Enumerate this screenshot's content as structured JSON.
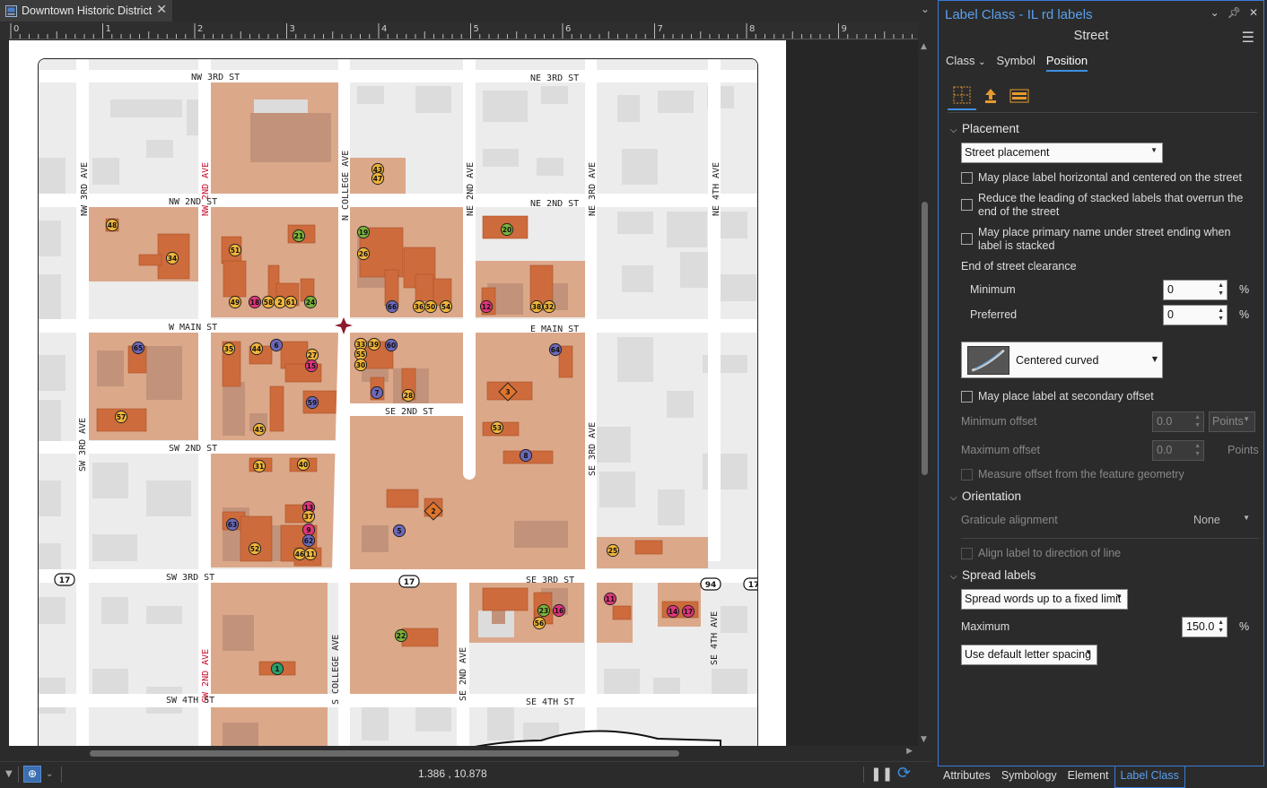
{
  "document_tab": {
    "title": "Downtown Historic District"
  },
  "ruler": {
    "labels": [
      "0",
      "1",
      "2",
      "3",
      "4",
      "5",
      "6",
      "7",
      "8",
      "9"
    ]
  },
  "map": {
    "streets": {
      "nw3rd_st": "NW 3RD ST",
      "ne3rd_st": "NE 3RD ST",
      "nw2nd_st": "NW 2ND ST",
      "ne2nd_st": "NE 2ND ST",
      "w_main_st": "W MAIN ST",
      "e_main_st": "E MAIN ST",
      "se2nd_st": "SE 2ND ST",
      "sw2nd_st": "SW 2ND ST",
      "sw3rd_st": "SW 3RD ST",
      "se3rd_st": "SE 3RD ST",
      "sw4th_st": "SW 4TH ST",
      "se4th_st": "SE 4TH ST",
      "nw3rd_ave": "NW 3RD AVE",
      "nw2nd_ave": "NW 2ND AVE",
      "n_college_ave": "N COLLEGE AVE",
      "ne2nd_ave": "NE 2ND AVE",
      "ne3rd_ave": "NE 3RD AVE",
      "ne4th_ave": "NE 4TH AVE",
      "sw3rd_ave": "SW 3RD AVE",
      "se3rd_ave": "SE 3RD AVE",
      "sw2nd_ave": "SW 2ND AVE",
      "s_college_ave": "S COLLEGE AVE",
      "se2nd_ave": "SE 2ND AVE",
      "se4th_ave": "SE 4TH AVE"
    },
    "shields": [
      "17",
      "17",
      "94",
      "17"
    ],
    "markers": [
      {
        "n": "48",
        "c": "yellow"
      },
      {
        "n": "34",
        "c": "yellow"
      },
      {
        "n": "51",
        "c": "yellow"
      },
      {
        "n": "21",
        "c": "green"
      },
      {
        "n": "49",
        "c": "yellow"
      },
      {
        "n": "18",
        "c": "pink"
      },
      {
        "n": "58",
        "c": "yellow"
      },
      {
        "n": "2",
        "c": "yellow"
      },
      {
        "n": "61",
        "c": "yellow"
      },
      {
        "n": "24",
        "c": "green"
      },
      {
        "n": "43",
        "c": "yellow"
      },
      {
        "n": "47",
        "c": "yellow"
      },
      {
        "n": "19",
        "c": "green"
      },
      {
        "n": "26",
        "c": "yellow"
      },
      {
        "n": "66",
        "c": "purple"
      },
      {
        "n": "36",
        "c": "yellow"
      },
      {
        "n": "50",
        "c": "yellow"
      },
      {
        "n": "54",
        "c": "yellow"
      },
      {
        "n": "20",
        "c": "green"
      },
      {
        "n": "12",
        "c": "pink"
      },
      {
        "n": "38",
        "c": "yellow"
      },
      {
        "n": "32",
        "c": "yellow"
      },
      {
        "n": "65",
        "c": "purple"
      },
      {
        "n": "35",
        "c": "yellow"
      },
      {
        "n": "44",
        "c": "yellow"
      },
      {
        "n": "6",
        "c": "purple"
      },
      {
        "n": "27",
        "c": "yellow"
      },
      {
        "n": "15",
        "c": "pink"
      },
      {
        "n": "33",
        "c": "yellow"
      },
      {
        "n": "39",
        "c": "yellow"
      },
      {
        "n": "60",
        "c": "purple"
      },
      {
        "n": "55",
        "c": "yellow"
      },
      {
        "n": "30",
        "c": "yellow"
      },
      {
        "n": "64",
        "c": "purple"
      },
      {
        "n": "59",
        "c": "purple"
      },
      {
        "n": "7",
        "c": "purple"
      },
      {
        "n": "28",
        "c": "yellow"
      },
      {
        "n": "3",
        "c": "orange"
      },
      {
        "n": "57",
        "c": "yellow"
      },
      {
        "n": "45",
        "c": "yellow"
      },
      {
        "n": "53",
        "c": "yellow"
      },
      {
        "n": "8",
        "c": "purple"
      },
      {
        "n": "31",
        "c": "yellow"
      },
      {
        "n": "40",
        "c": "yellow"
      },
      {
        "n": "13",
        "c": "pink"
      },
      {
        "n": "37",
        "c": "yellow"
      },
      {
        "n": "63",
        "c": "purple"
      },
      {
        "n": "9",
        "c": "pink"
      },
      {
        "n": "62",
        "c": "purple"
      },
      {
        "n": "52",
        "c": "yellow"
      },
      {
        "n": "46",
        "c": "yellow"
      },
      {
        "n": "11",
        "c": "yellow"
      },
      {
        "n": "2",
        "c": "orange"
      },
      {
        "n": "5",
        "c": "purple"
      },
      {
        "n": "25",
        "c": "yellow"
      },
      {
        "n": "11",
        "c": "pink"
      },
      {
        "n": "23",
        "c": "green"
      },
      {
        "n": "16",
        "c": "pink"
      },
      {
        "n": "56",
        "c": "yellow"
      },
      {
        "n": "14",
        "c": "pink"
      },
      {
        "n": "17",
        "c": "pink"
      },
      {
        "n": "22",
        "c": "green"
      },
      {
        "n": "1",
        "c": "teal"
      }
    ],
    "colors": {
      "block": "#dca88a",
      "building": "#cd6b3c",
      "lightbuilding": "#c2937a",
      "star": "#8b1a2c",
      "street": "#ffffff",
      "bg": "#ececec"
    }
  },
  "status": {
    "coordinates": "1.386 , 10.878"
  },
  "pane": {
    "title": "Label Class - IL rd labels",
    "subtitle": "Street",
    "tabs": [
      "Class",
      "Symbol",
      "Position"
    ],
    "active_tab": "Position",
    "placement": {
      "header": "Placement",
      "mode": "Street placement",
      "chk_horizontal": "May place label horizontal and centered on the street",
      "chk_leading": "Reduce the leading of stacked labels that overrun the end of the street",
      "chk_primary": "May place primary name under street ending when label is stacked",
      "clearance_label": "End of street clearance",
      "minimum_label": "Minimum",
      "minimum_value": "0",
      "preferred_label": "Preferred",
      "preferred_value": "0",
      "percent": "%",
      "curve_style": "Centered curved",
      "chk_secondary": "May place label at secondary offset",
      "min_offset_label": "Minimum offset",
      "min_offset_value": "0.0",
      "max_offset_label": "Maximum offset",
      "max_offset_value": "0.0",
      "points_unit": "Points",
      "points_unit2": "Points",
      "chk_measure": "Measure offset from the feature geometry"
    },
    "orientation": {
      "header": "Orientation",
      "graticule_label": "Graticule alignment",
      "graticule_value": "None",
      "chk_align": "Align label to direction of line"
    },
    "spread": {
      "header": "Spread labels",
      "mode": "Spread words up to a fixed limit",
      "maximum_label": "Maximum",
      "maximum_value": "150.0",
      "percent": "%",
      "spacing": "Use default letter spacing"
    }
  },
  "bottom_tabs": [
    "Attributes",
    "Symbology",
    "Element",
    "Label Class"
  ],
  "bottom_active": "Label Class"
}
